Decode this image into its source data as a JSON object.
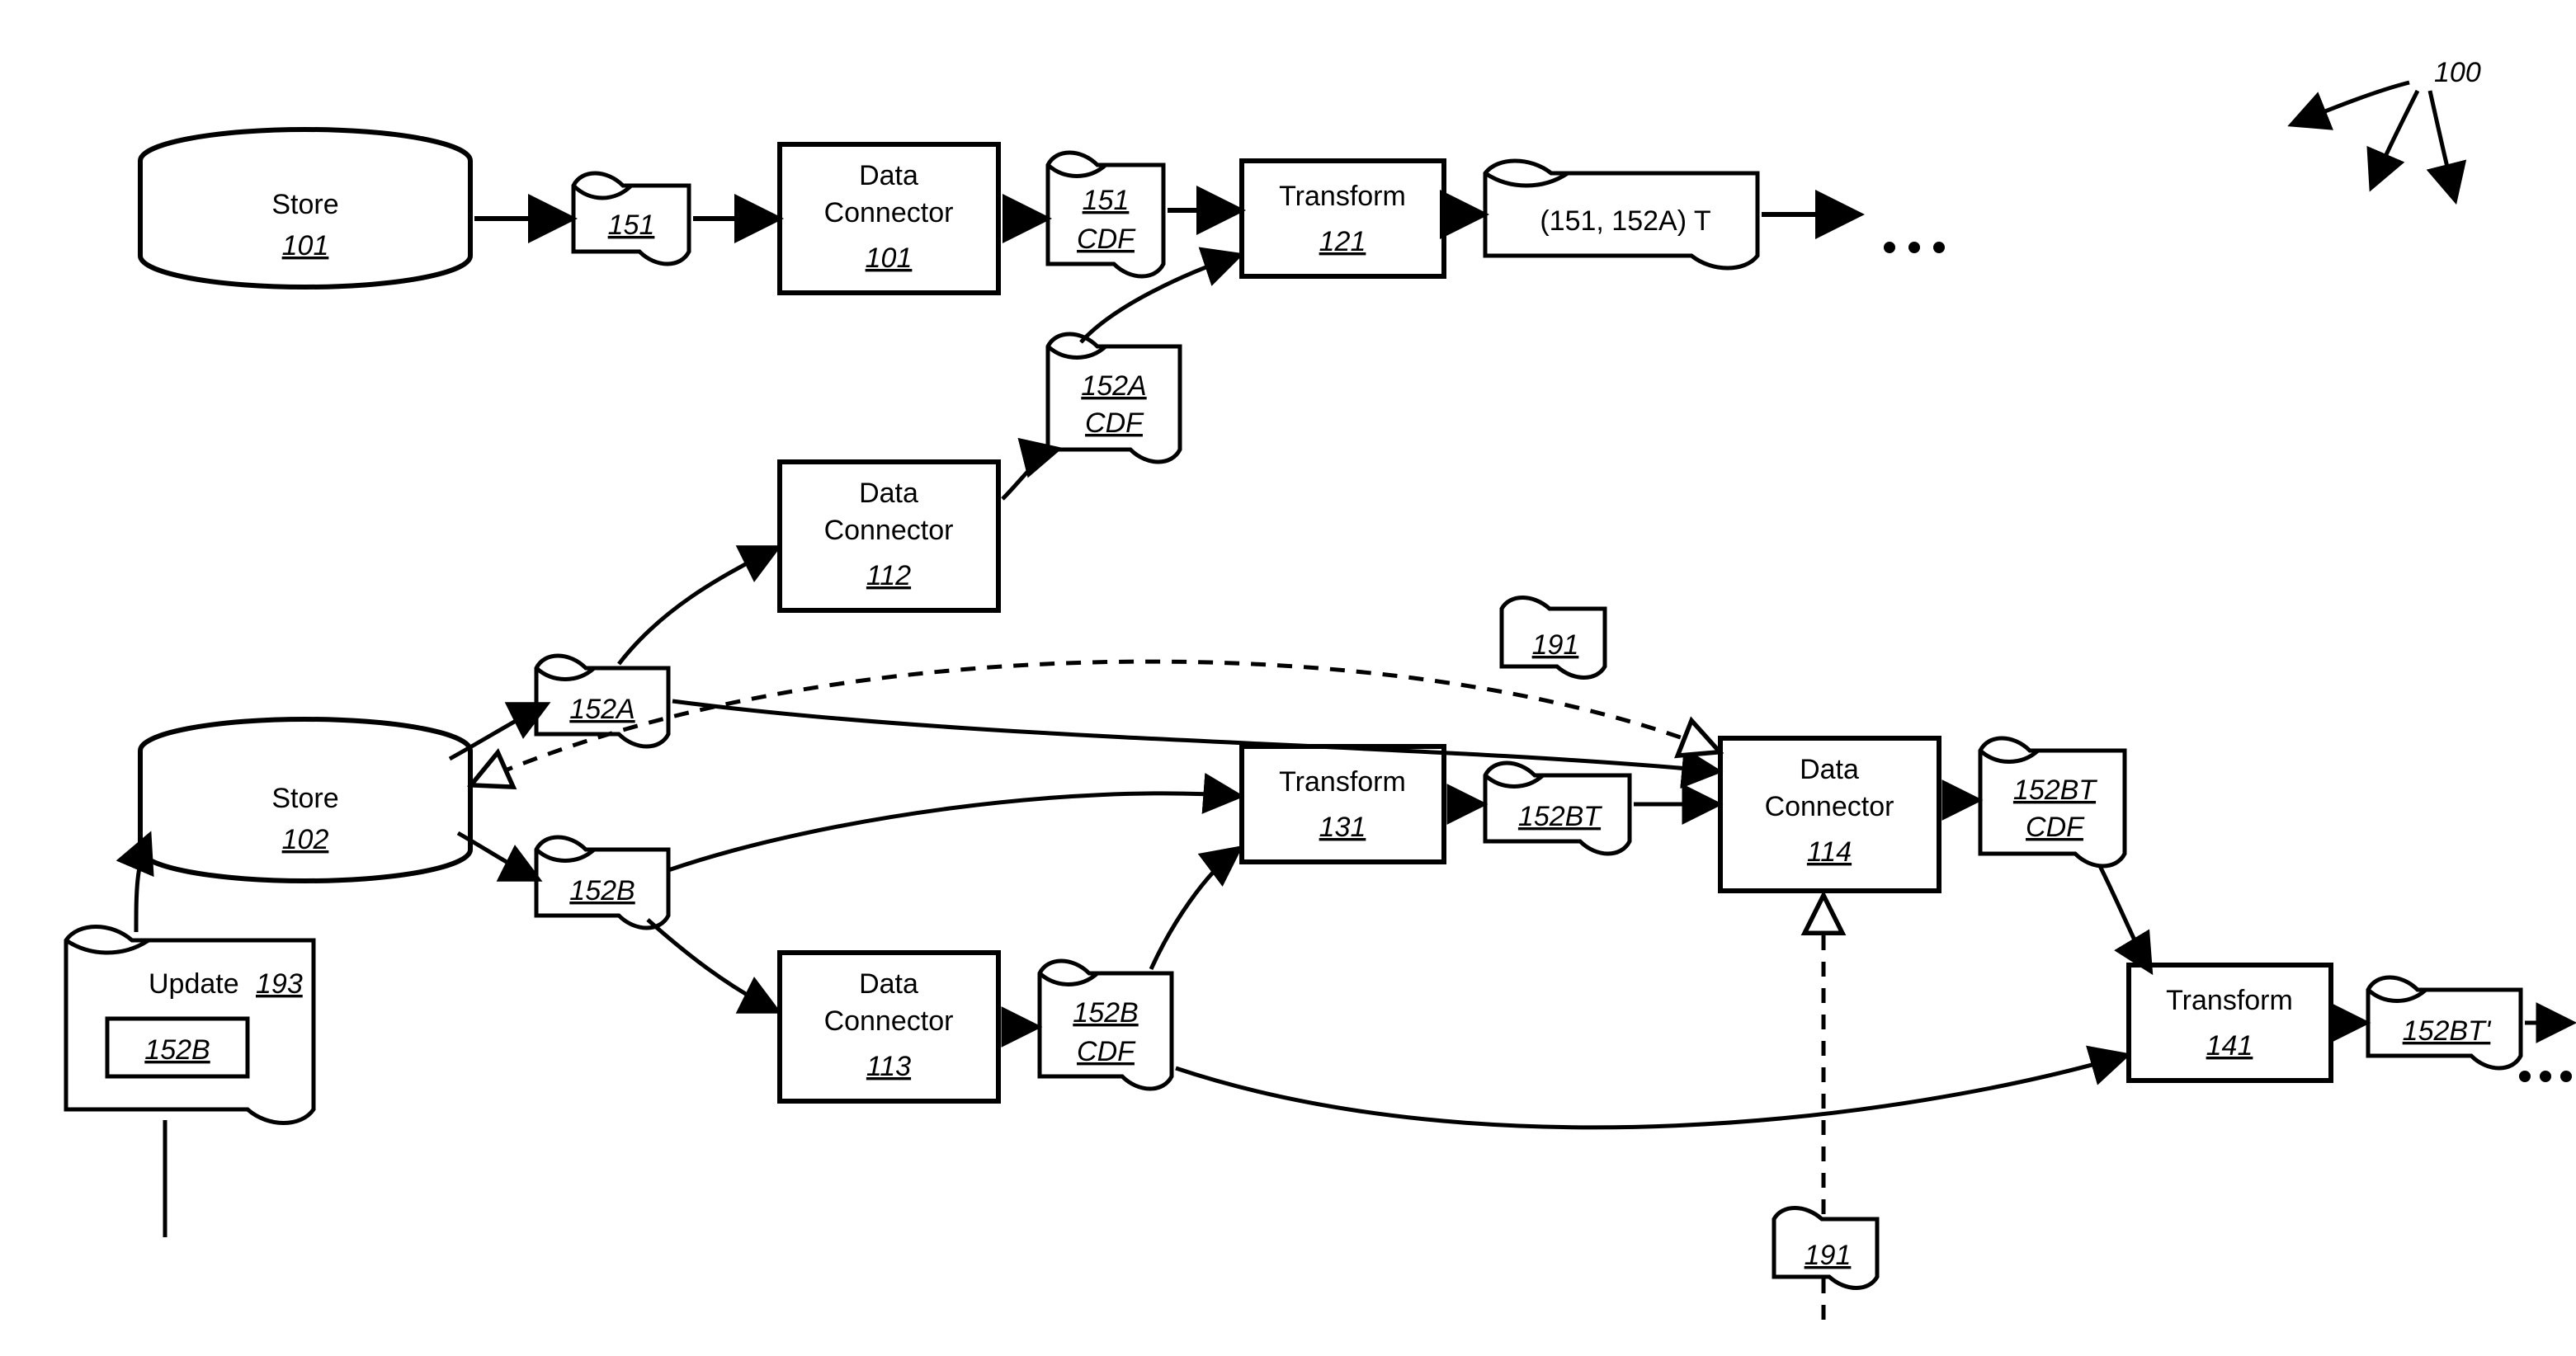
{
  "fig": {
    "ref": "100"
  },
  "stores": {
    "s101": {
      "label": "Store",
      "ref": "101"
    },
    "s102": {
      "label": "Store",
      "ref": "102"
    }
  },
  "connectors": {
    "c101": {
      "line1": "Data",
      "line2": "Connector",
      "ref": "101"
    },
    "c112": {
      "line1": "Data",
      "line2": "Connector",
      "ref": "112"
    },
    "c113": {
      "line1": "Data",
      "line2": "Connector",
      "ref": "113"
    },
    "c114": {
      "line1": "Data",
      "line2": "Connector",
      "ref": "114"
    }
  },
  "transforms": {
    "t121": {
      "label": "Transform",
      "ref": "121"
    },
    "t131": {
      "label": "Transform",
      "ref": "131"
    },
    "t141": {
      "label": "Transform",
      "ref": "141"
    }
  },
  "docs": {
    "d151": {
      "l1": "151"
    },
    "d151cdf": {
      "l1": "151",
      "l2": "CDF"
    },
    "d_151_152a_T": {
      "text": "(151, 152A) T"
    },
    "d152acdf": {
      "l1": "152A",
      "l2": "CDF"
    },
    "d152a": {
      "l1": "152A"
    },
    "d152b": {
      "l1": "152B"
    },
    "d152bcdf": {
      "l1": "152B",
      "l2": "CDF"
    },
    "d152bt": {
      "l1": "152BT"
    },
    "d152btcdf": {
      "l1": "152BT",
      "l2": "CDF"
    },
    "d152btprime": {
      "l1": "152BT'"
    },
    "dupdate": {
      "label": "Update",
      "ref": "193",
      "inner": "152B"
    },
    "r191a": {
      "l1": "191"
    },
    "r191b": {
      "l1": "191"
    }
  }
}
